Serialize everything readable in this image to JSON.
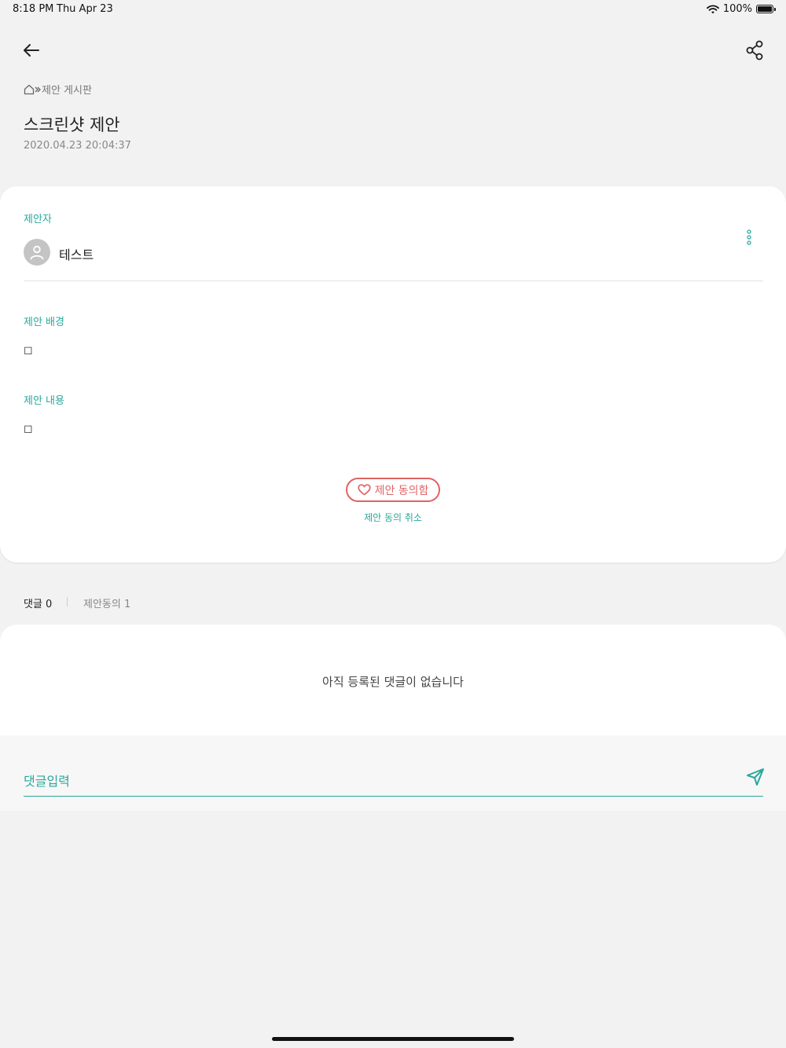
{
  "status_bar": {
    "time": "8:18 PM",
    "date": "Thu Apr 23",
    "battery": "100%",
    "battery_level": 1.0
  },
  "header": {
    "back_icon": "arrow-left-icon",
    "share_icon": "share-icon"
  },
  "breadcrumb": {
    "home_icon": "home-icon",
    "separator_icon": "chevron-right-icon",
    "board": "제안 게시판"
  },
  "post": {
    "title": "스크린샷 제안",
    "date": "2020.04.23 20:04:37",
    "author_label": "제안자",
    "author_name": "테스트",
    "background_label": "제안 배경",
    "background_text": "◻",
    "content_label": "제안 내용",
    "content_text": "◻",
    "agree_label": "제안 동의함",
    "cancel_agree_label": "제안 동의 취소"
  },
  "tabs": {
    "comments": "댓글 0",
    "agrees": "제안동의 1"
  },
  "comments": {
    "empty_message": "아직 등록된 댓글이 없습니다"
  },
  "comment_input": {
    "placeholder": "댓글입력",
    "value": ""
  },
  "colors": {
    "accent": "#2aa89c",
    "agree": "#e06464",
    "background": "#f2f2f2"
  }
}
